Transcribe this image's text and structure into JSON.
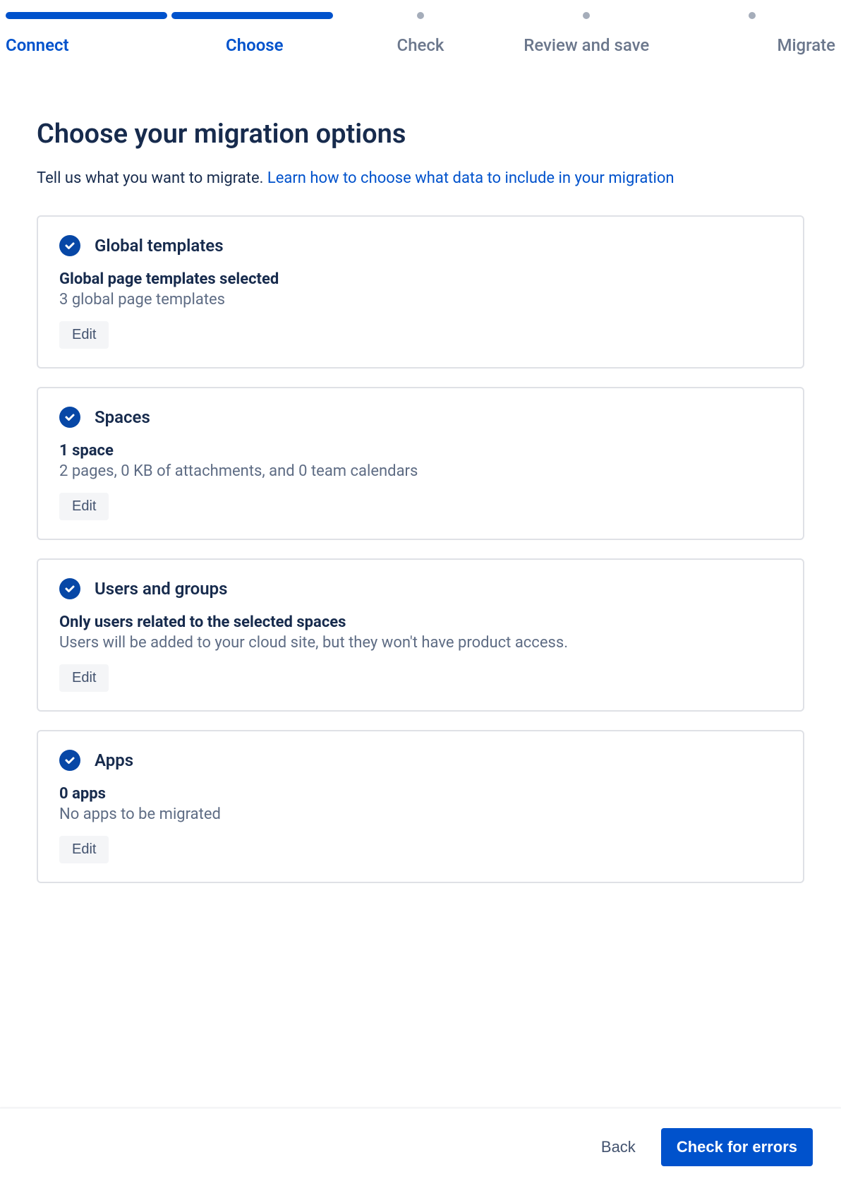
{
  "stepper": {
    "steps": [
      {
        "label": "Connect",
        "state": "done"
      },
      {
        "label": "Choose",
        "state": "current"
      },
      {
        "label": "Check",
        "state": "upcoming"
      },
      {
        "label": "Review and save",
        "state": "upcoming"
      },
      {
        "label": "Migrate",
        "state": "upcoming"
      }
    ]
  },
  "page": {
    "title": "Choose your migration options",
    "intro_text": "Tell us what you want to migrate. ",
    "intro_link": "Learn how to choose what data to include in your migration"
  },
  "cards": {
    "global_templates": {
      "title": "Global templates",
      "strong": "Global page templates selected",
      "sub": "3 global page templates",
      "edit_label": "Edit"
    },
    "spaces": {
      "title": "Spaces",
      "strong": "1 space",
      "sub": "2 pages, 0 KB of attachments, and 0 team calendars",
      "edit_label": "Edit"
    },
    "users_groups": {
      "title": "Users and groups",
      "strong": "Only users related to the selected spaces",
      "sub": "Users will be added to your cloud site, but they won't have product access.",
      "edit_label": "Edit"
    },
    "apps": {
      "title": "Apps",
      "strong": "0 apps",
      "sub": "No apps to be migrated",
      "edit_label": "Edit"
    }
  },
  "footer": {
    "back_label": "Back",
    "primary_label": "Check for errors"
  }
}
